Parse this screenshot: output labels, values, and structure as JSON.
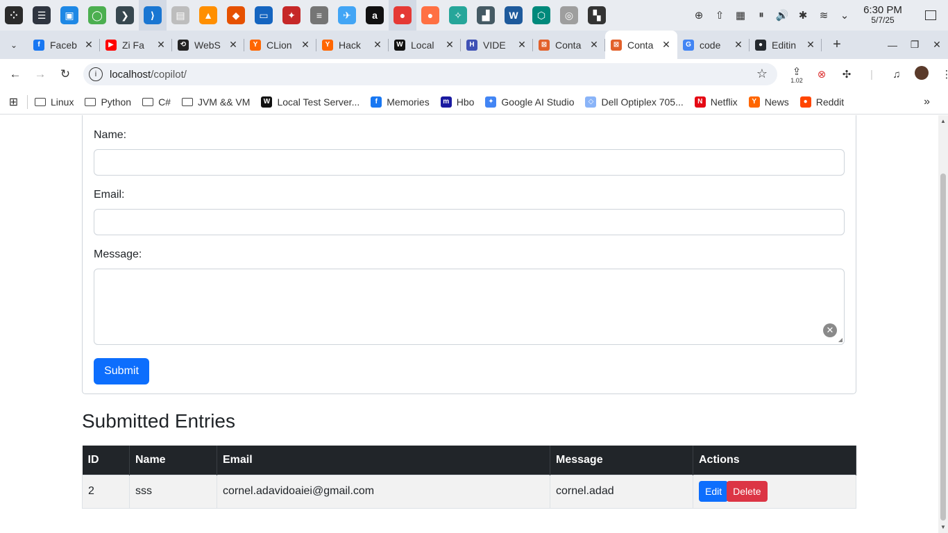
{
  "taskbar": {
    "apps": [
      {
        "name": "launcher-icon",
        "color": "#2b2b2b",
        "glyph": "⁘"
      },
      {
        "name": "settings-panel-icon",
        "color": "#2f3540",
        "glyph": "☰"
      },
      {
        "name": "store-icon",
        "color": "#1e88e5",
        "glyph": "▣"
      },
      {
        "name": "qt-creator-icon",
        "color": "#4caf50",
        "glyph": "◯"
      },
      {
        "name": "terminal-icon",
        "color": "#37474f",
        "glyph": "❯"
      },
      {
        "name": "vscode-icon",
        "color": "#1976d2",
        "glyph": "⟩"
      },
      {
        "name": "files-icon",
        "color": "#bdbdbd",
        "glyph": "▤"
      },
      {
        "name": "vlc-icon",
        "color": "#ff8f00",
        "glyph": "▲"
      },
      {
        "name": "fish-app-icon",
        "color": "#e65100",
        "glyph": "◆"
      },
      {
        "name": "window-app-icon",
        "color": "#1565c0",
        "glyph": "▭"
      },
      {
        "name": "race-car-icon",
        "color": "#c62828",
        "glyph": "✦"
      },
      {
        "name": "database-icon",
        "color": "#757575",
        "glyph": "≡"
      },
      {
        "name": "browser-app-icon",
        "color": "#42a5f5",
        "glyph": "✈"
      },
      {
        "name": "a-app-icon",
        "color": "#111111",
        "glyph": "a"
      },
      {
        "name": "chrome-icon",
        "color": "#e53935",
        "glyph": "●"
      },
      {
        "name": "firefox-icon",
        "color": "#ff7043",
        "glyph": "●"
      },
      {
        "name": "remote-app-icon",
        "color": "#26a69a",
        "glyph": "✧"
      },
      {
        "name": "system-monitor-icon",
        "color": "#455a64",
        "glyph": "▟"
      },
      {
        "name": "wm-app-icon",
        "color": "#1e5a9c",
        "glyph": "W"
      },
      {
        "name": "cube-app-icon",
        "color": "#00897b",
        "glyph": "⬡"
      },
      {
        "name": "disc-icon",
        "color": "#9e9e9e",
        "glyph": "◎"
      },
      {
        "name": "grid-app-icon",
        "color": "#333333",
        "glyph": "▚"
      }
    ],
    "tray": [
      {
        "name": "translate-tray-icon",
        "glyph": "⊕"
      },
      {
        "name": "upload-tray-icon",
        "glyph": "⇧"
      },
      {
        "name": "clipboard-tray-icon",
        "glyph": "▦"
      },
      {
        "name": "pause-tray-icon",
        "glyph": "⏸"
      },
      {
        "name": "volume-tray-icon",
        "glyph": "🔊"
      },
      {
        "name": "bluetooth-tray-icon",
        "glyph": "✱"
      },
      {
        "name": "wifi-tray-icon",
        "glyph": "≋"
      },
      {
        "name": "chevron-down-tray-icon",
        "glyph": "⌄"
      }
    ],
    "time": "6:30 PM",
    "date": "5/7/25"
  },
  "tabs": [
    {
      "label": "Faceb",
      "fav_color": "#1877f2",
      "fav_glyph": "f"
    },
    {
      "label": "Zi Fa",
      "fav_color": "#ff0000",
      "fav_glyph": "▶"
    },
    {
      "label": "WebS",
      "fav_color": "#222222",
      "fav_glyph": "⟲"
    },
    {
      "label": "CLion",
      "fav_color": "#ff6600",
      "fav_glyph": "Y"
    },
    {
      "label": "Hack",
      "fav_color": "#ff6600",
      "fav_glyph": "Y"
    },
    {
      "label": "Local",
      "fav_color": "#111111",
      "fav_glyph": "W"
    },
    {
      "label": "VIDE",
      "fav_color": "#3f51b5",
      "fav_glyph": "H"
    },
    {
      "label": "Conta",
      "fav_color": "#e2602a",
      "fav_glyph": "⊠"
    },
    {
      "label": "Conta",
      "fav_color": "#e2602a",
      "fav_glyph": "⊠",
      "active": true
    },
    {
      "label": "code",
      "fav_color": "#4285f4",
      "fav_glyph": "G"
    },
    {
      "label": "Editin",
      "fav_color": "#24292e",
      "fav_glyph": "●"
    }
  ],
  "address": {
    "host": "localhost",
    "path": "/copilot/"
  },
  "toolbar": {
    "ext_badge": "1.02"
  },
  "bookmarks": [
    {
      "label": "Linux",
      "type": "folder"
    },
    {
      "label": "Python",
      "type": "folder"
    },
    {
      "label": "C#",
      "type": "folder"
    },
    {
      "label": "JVM && VM",
      "type": "folder"
    },
    {
      "label": "Local Test Server...",
      "type": "site",
      "color": "#111111",
      "glyph": "W"
    },
    {
      "label": "Memories",
      "type": "site",
      "color": "#1877f2",
      "glyph": "f"
    },
    {
      "label": "Hbo",
      "type": "site",
      "color": "#1a1aa0",
      "glyph": "m"
    },
    {
      "label": "Google AI Studio",
      "type": "site",
      "color": "#4285f4",
      "glyph": "✦"
    },
    {
      "label": "Dell Optiplex 705...",
      "type": "site",
      "color": "#8ab4f8",
      "glyph": "◇"
    },
    {
      "label": "Netflix",
      "type": "site",
      "color": "#e50914",
      "glyph": "N"
    },
    {
      "label": "News",
      "type": "site",
      "color": "#ff6600",
      "glyph": "Y"
    },
    {
      "label": "Reddit",
      "type": "site",
      "color": "#ff4500",
      "glyph": "●"
    }
  ],
  "form": {
    "name_label": "Name:",
    "email_label": "Email:",
    "message_label": "Message:",
    "name_value": "",
    "email_value": "",
    "message_value": "",
    "submit_label": "Submit"
  },
  "entries": {
    "title": "Submitted Entries",
    "columns": [
      "ID",
      "Name",
      "Email",
      "Message",
      "Actions"
    ],
    "rows": [
      {
        "id": "2",
        "name": "sss",
        "email": "cornel.adavidoaiei@gmail.com",
        "message": "cornel.adad",
        "edit_label": "Edit",
        "delete_label": "Delete"
      }
    ]
  },
  "colors": {
    "primary": "#0d6efd",
    "danger": "#dc3545",
    "table_header": "#212529"
  }
}
